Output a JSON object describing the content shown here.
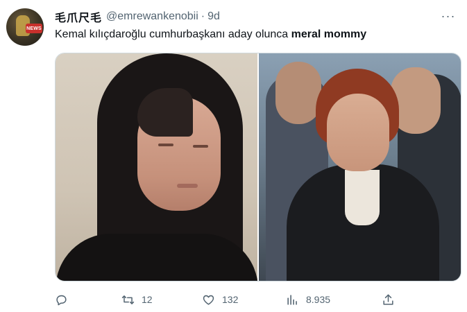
{
  "tweet": {
    "display_name": "毛爪尺毛",
    "handle": "@emrewankenobii",
    "separator": "·",
    "time": "9d",
    "avatar_badge": "NEWS",
    "text_plain": "Kemal kılıçdaroğlu cumhurbaşkanı aday olunca ",
    "text_bold": "meral mommy",
    "more_icon": "more-horizontal-icon"
  },
  "actions": {
    "reply": {
      "icon": "reply-icon",
      "count": ""
    },
    "retweet": {
      "icon": "retweet-icon",
      "count": "12"
    },
    "like": {
      "icon": "heart-icon",
      "count": "132"
    },
    "views": {
      "icon": "views-icon",
      "count": "8.935"
    },
    "share": {
      "icon": "share-icon",
      "count": ""
    }
  },
  "colors": {
    "text_primary": "#0f1419",
    "text_secondary": "#536471",
    "border": "#cfd9de"
  }
}
